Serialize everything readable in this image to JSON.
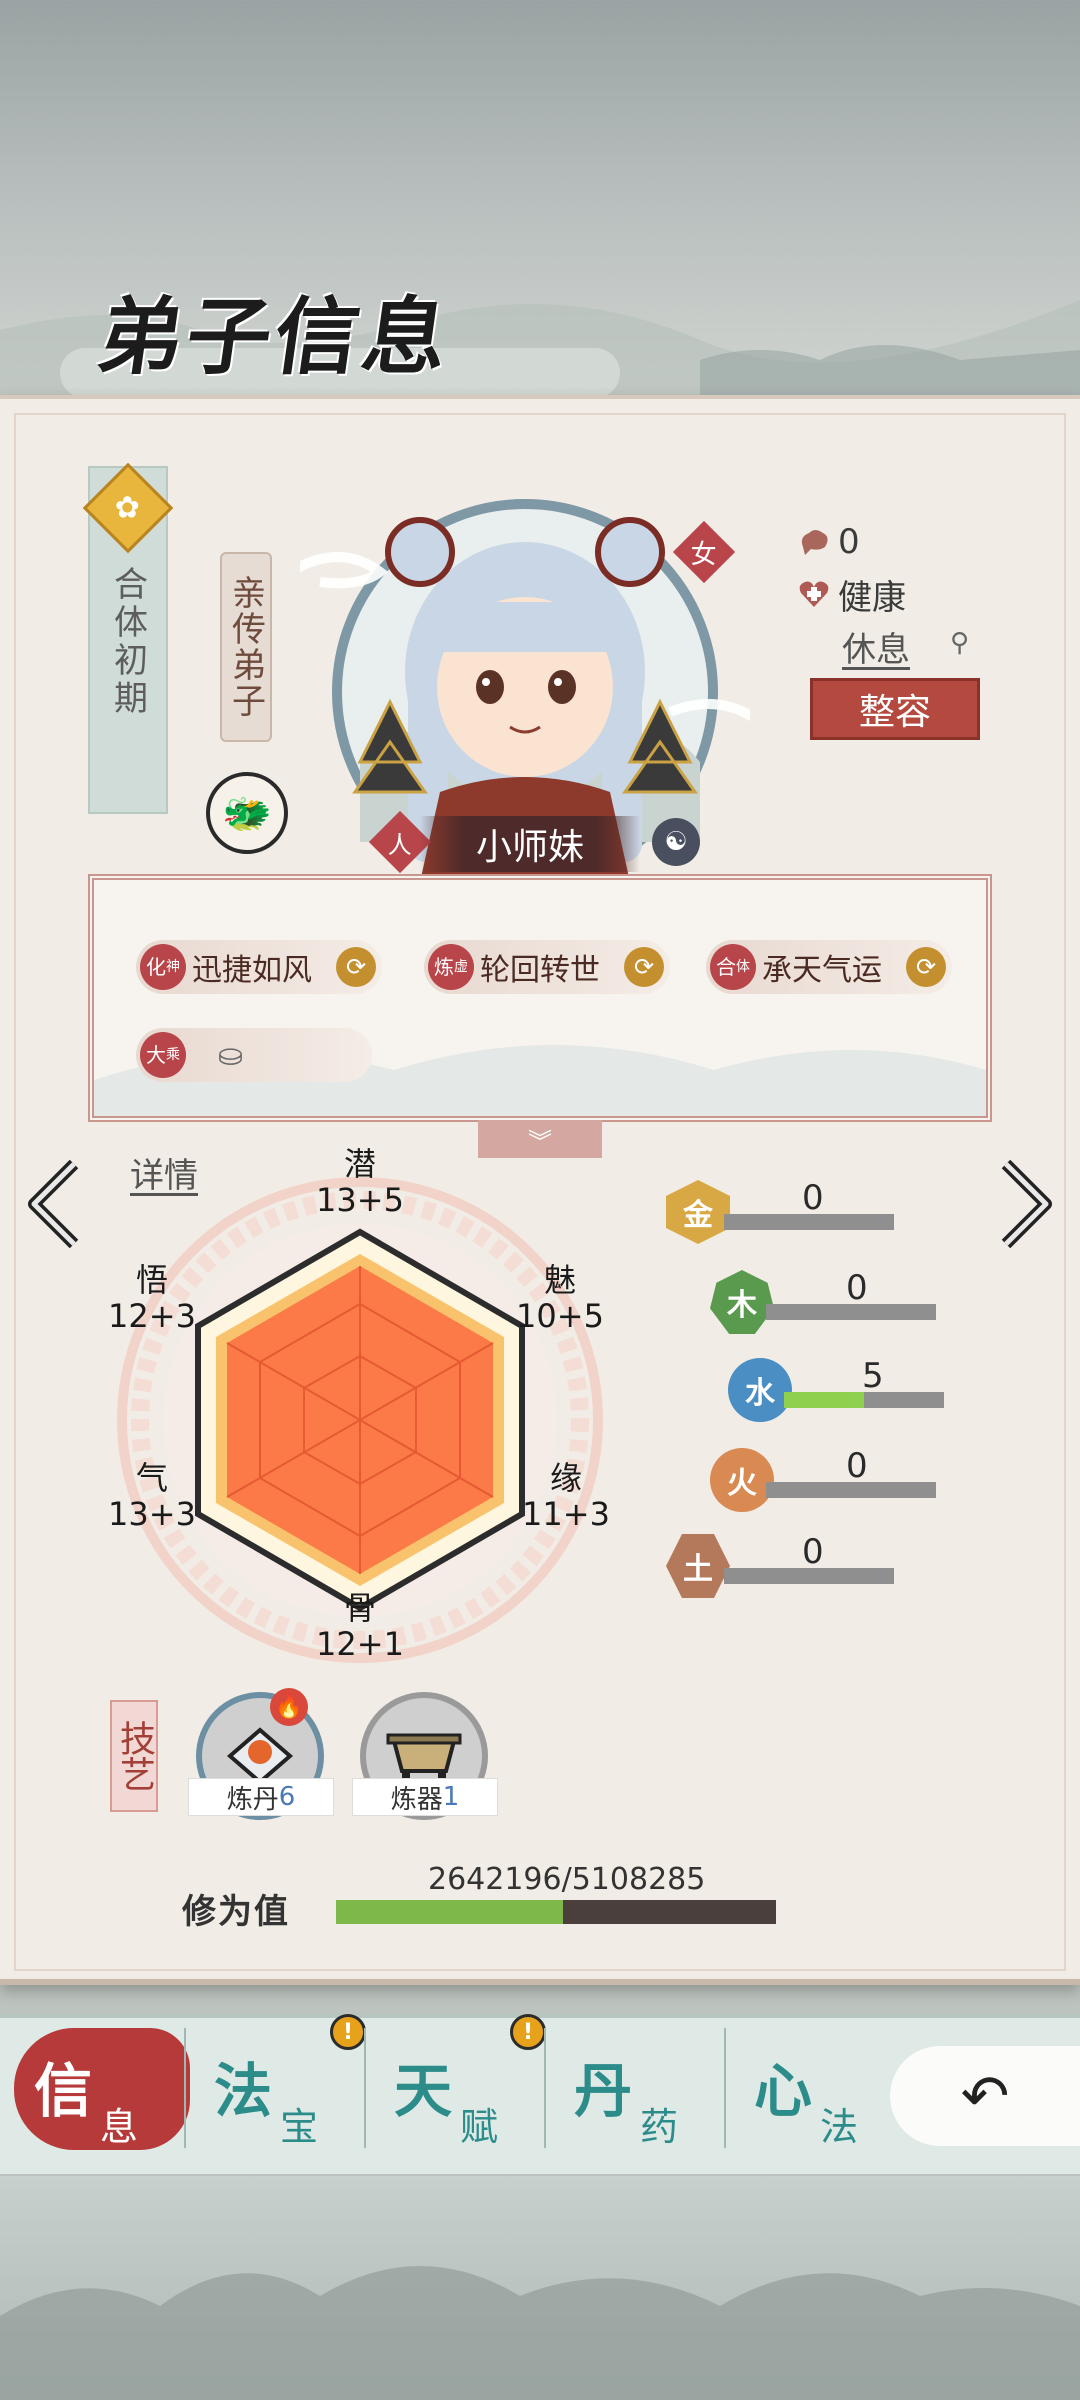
{
  "header": {
    "title": "弟子信息"
  },
  "disciple": {
    "realm": "合体初期",
    "rank": "亲传弟子",
    "gender": "女",
    "race": "人",
    "name": "小师妹",
    "mood_value": "0",
    "health": "健康",
    "activity": "休息",
    "makeover_label": "整容"
  },
  "traits": [
    {
      "level_top": "化",
      "level_bottom": "神",
      "name": "迅捷如风"
    },
    {
      "level_top": "炼",
      "level_bottom": "虚",
      "name": "轮回转世"
    },
    {
      "level_top": "合",
      "level_bottom": "体",
      "name": "承天气运"
    },
    {
      "level_top": "大",
      "level_bottom": "乘",
      "name": ""
    }
  ],
  "detail_link": "详情",
  "attributes": {
    "qian": {
      "label": "潜",
      "value": "13+5"
    },
    "mei": {
      "label": "魅",
      "value": "10+5"
    },
    "yuan": {
      "label": "缘",
      "value": "11+3"
    },
    "gu": {
      "label": "骨",
      "value": "12+1"
    },
    "qi": {
      "label": "气",
      "value": "13+3"
    },
    "wu": {
      "label": "悟",
      "value": "12+3"
    }
  },
  "elements": [
    {
      "name": "金",
      "value": "0",
      "level": 0,
      "color": "#d7a843"
    },
    {
      "name": "木",
      "value": "0",
      "level": 0,
      "color": "#5a9a4e"
    },
    {
      "name": "水",
      "value": "5",
      "level": 0.5,
      "color": "#4b8ec4"
    },
    {
      "name": "火",
      "value": "0",
      "level": 0,
      "color": "#d98a52"
    },
    {
      "name": "土",
      "value": "0",
      "level": 0,
      "color": "#b4795a"
    }
  ],
  "skills_tag": "技艺",
  "skills": [
    {
      "name": "炼丹",
      "level": "6"
    },
    {
      "name": "炼器",
      "level": "1"
    }
  ],
  "cultivation": {
    "label": "修为值",
    "value": "2642196/5108285",
    "progress": 0.517
  },
  "tabs": [
    {
      "big": "信",
      "small": "息",
      "active": true
    },
    {
      "big": "法",
      "small": "宝",
      "alert": true
    },
    {
      "big": "天",
      "small": "赋",
      "alert": true
    },
    {
      "big": "丹",
      "small": "药"
    },
    {
      "big": "心",
      "small": "法"
    }
  ],
  "alert_symbol": "!"
}
